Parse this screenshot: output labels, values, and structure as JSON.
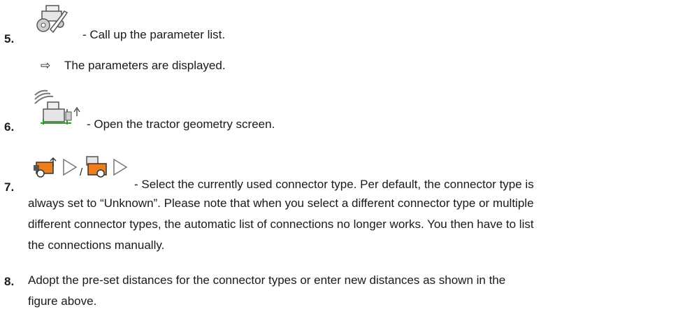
{
  "steps": [
    {
      "number": "5.",
      "icon": "tractor-wrench-icon",
      "text": "- Call up the parameter list.",
      "result_arrow": "⇨",
      "result_text": "The parameters are displayed."
    },
    {
      "number": "6.",
      "icon": "tractor-geometry-icon",
      "text": "- Open the tractor geometry screen."
    },
    {
      "number": "7.",
      "icons": [
        "connector-front-icon",
        "play-triangle-icon",
        "connector-rear-icon",
        "play-triangle-icon"
      ],
      "separator": "/",
      "text_lines": [
        "- Select the currently used connector type. Per default, the connector type is",
        "always set to “Unknown”. Please note that when you select a different connector type or multiple",
        "different connector types, the automatic list of connections no longer works. You then have to list",
        "the connections manually."
      ]
    },
    {
      "number": "8.",
      "text_lines": [
        "Adopt the pre-set distances for the connector types or enter new distances as shown in the",
        "figure above."
      ]
    }
  ]
}
